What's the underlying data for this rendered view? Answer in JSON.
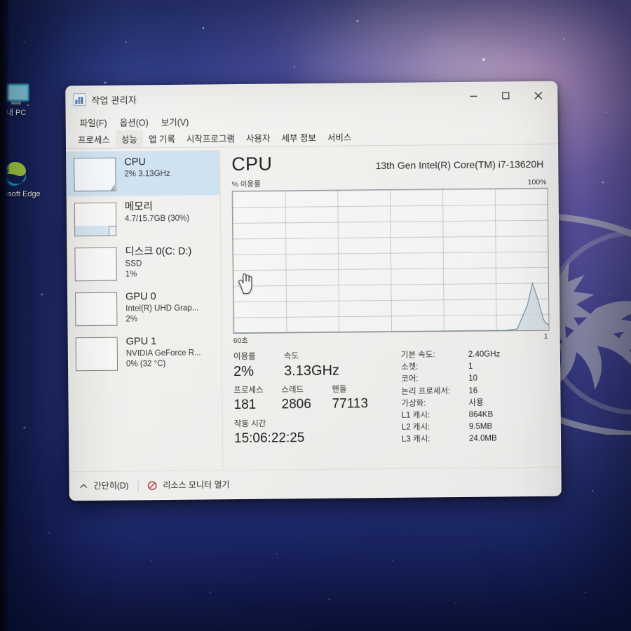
{
  "desktop": {
    "icons": [
      {
        "name": "this-pc",
        "label": "내 PC",
        "glyph": "this-pc-icon"
      },
      {
        "name": "microsoft-edge",
        "label": "Microsoft Edge",
        "glyph": "edge-icon"
      }
    ],
    "wallpaper_logo": "msi-dragon-logo"
  },
  "window": {
    "title": "작업 관리자",
    "app_icon": "task-manager-icon",
    "controls": {
      "minimize": "minimize-icon",
      "maximize": "maximize-icon",
      "close": "close-icon"
    }
  },
  "menu": {
    "items": [
      {
        "label": "파일(F)"
      },
      {
        "label": "옵션(O)"
      },
      {
        "label": "보기(V)"
      }
    ]
  },
  "tabs": {
    "active_index": 1,
    "items": [
      {
        "label": "프로세스"
      },
      {
        "label": "성능"
      },
      {
        "label": "앱 기록"
      },
      {
        "label": "시작프로그램"
      },
      {
        "label": "사용자"
      },
      {
        "label": "세부 정보"
      },
      {
        "label": "서비스"
      }
    ]
  },
  "sidebar": {
    "selected_index": 0,
    "items": [
      {
        "name": "cpu",
        "title": "CPU",
        "sub1": "2% 3.13GHz",
        "sub2": "",
        "fill_pct": 2
      },
      {
        "name": "memory",
        "title": "메모리",
        "sub1": "4.7/15.7GB (30%)",
        "sub2": "",
        "fill_pct": 30
      },
      {
        "name": "disk-0",
        "title": "디스크 0(C: D:)",
        "sub1": "SSD",
        "sub2": "1%",
        "fill_pct": 1
      },
      {
        "name": "gpu-0",
        "title": "GPU 0",
        "sub1": "Intel(R) UHD Grap...",
        "sub2": "2%",
        "fill_pct": 2
      },
      {
        "name": "gpu-1",
        "title": "GPU 1",
        "sub1": "NVIDIA GeForce R...",
        "sub2": "0% (32 °C)",
        "fill_pct": 0
      }
    ]
  },
  "detail": {
    "heading": "CPU",
    "model": "13th Gen Intel(R) Core(TM) i7-13620H",
    "graph_axis_label": "% 이용률",
    "graph_max_label": "100%",
    "graph_time_start": "60초",
    "graph_time_end": "1",
    "stats_left": {
      "utilization_label": "이용률",
      "utilization_value": "2%",
      "speed_label": "속도",
      "speed_value": "3.13GHz",
      "processes_label": "프로세스",
      "processes_value": "181",
      "threads_label": "스레드",
      "threads_value": "2806",
      "handles_label": "핸들",
      "handles_value": "77113",
      "uptime_label": "작동 시간",
      "uptime_value": "15:06:22:25"
    },
    "stats_right": [
      {
        "key": "기본 속도:",
        "value": "2.40GHz"
      },
      {
        "key": "소켓:",
        "value": "1"
      },
      {
        "key": "코어:",
        "value": "10"
      },
      {
        "key": "논리 프로세서:",
        "value": "16"
      },
      {
        "key": "가상화:",
        "value": "사용"
      },
      {
        "key": "L1 캐시:",
        "value": "864KB"
      },
      {
        "key": "L2 캐시:",
        "value": "9.5MB"
      },
      {
        "key": "L3 캐시:",
        "value": "24.0MB"
      }
    ]
  },
  "statusbar": {
    "collapse_label": "간단히(D)",
    "collapse_icon": "chevron-up-icon",
    "resource_monitor_label": "리소스 모니터 열기",
    "resource_monitor_icon": "resource-monitor-icon"
  },
  "colors": {
    "selection_blue": "#c9dff0",
    "graph_line": "#6f8fa8",
    "graph_fill": "#c9d6e0",
    "window_bg": "#efeeeb",
    "accent_red": "#c0392b"
  },
  "chart_data": {
    "type": "area",
    "title": "% 이용률",
    "xlabel": "",
    "ylabel": "% 이용률",
    "ylim": [
      0,
      100
    ],
    "xlim_labels": [
      "60초",
      "1"
    ],
    "grid": true,
    "legend": "none",
    "x": [
      0,
      52,
      54,
      56,
      57,
      58,
      59,
      59.4,
      60
    ],
    "values": [
      0,
      0,
      1,
      18,
      33,
      22,
      8,
      5,
      4
    ]
  }
}
